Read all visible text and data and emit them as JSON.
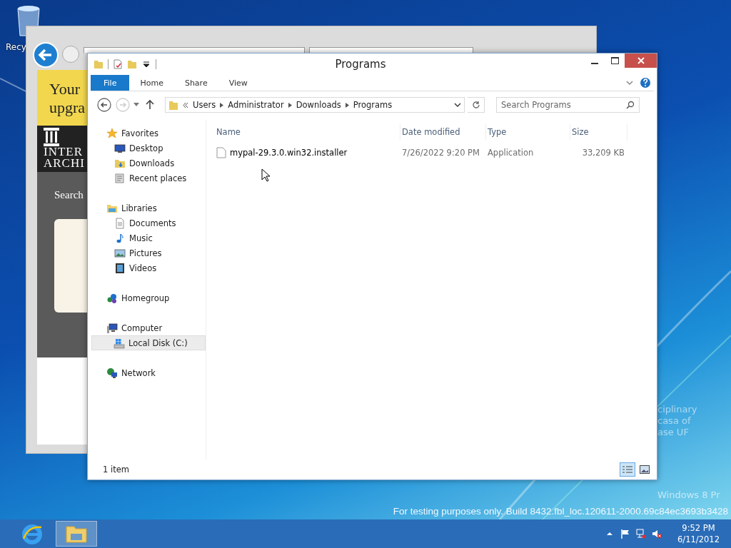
{
  "desktop": {
    "recycle_bin_label": "Recy",
    "wallpaper_texts": [
      "ciplinary",
      "casa of",
      "ase UF"
    ],
    "edition_text": "Windows 8 Pr",
    "build_text": "For testing purposes only. Build 8432.fbl_loc.120611-2000.69c84ec3693b3428"
  },
  "background_window": {
    "banner_lines": [
      "Your",
      "upgra"
    ],
    "logo_lines": [
      "INTER",
      "ARCHI"
    ],
    "search_label": "Search"
  },
  "explorer": {
    "title": "Programs",
    "ribbon_tabs": [
      {
        "label": "File",
        "selected": true
      },
      {
        "label": "Home",
        "selected": false
      },
      {
        "label": "Share",
        "selected": false
      },
      {
        "label": "View",
        "selected": false
      }
    ],
    "breadcrumb": [
      "Users",
      "Administrator",
      "Downloads",
      "Programs"
    ],
    "search": {
      "placeholder": "Search Programs"
    },
    "navigation": [
      {
        "label": "Favorites",
        "kind": "star",
        "selected": false,
        "children": [
          {
            "label": "Desktop",
            "kind": "desktop",
            "selected": false
          },
          {
            "label": "Downloads",
            "kind": "downloads",
            "selected": false
          },
          {
            "label": "Recent places",
            "kind": "recent",
            "selected": false
          }
        ]
      },
      {
        "label": "Libraries",
        "kind": "library",
        "selected": false,
        "children": [
          {
            "label": "Documents",
            "kind": "document",
            "selected": false
          },
          {
            "label": "Music",
            "kind": "music",
            "selected": false
          },
          {
            "label": "Pictures",
            "kind": "pictures",
            "selected": false
          },
          {
            "label": "Videos",
            "kind": "videos",
            "selected": false
          }
        ]
      },
      {
        "label": "Homegroup",
        "kind": "homegroup",
        "selected": false
      },
      {
        "label": "Computer",
        "kind": "computer",
        "selected": false,
        "children": [
          {
            "label": "Local Disk (C:)",
            "kind": "disk",
            "selected": true
          }
        ]
      },
      {
        "label": "Network",
        "kind": "network",
        "selected": false
      }
    ],
    "columns": [
      "Name",
      "Date modified",
      "Type",
      "Size"
    ],
    "rows": [
      {
        "name": "mypal-29.3.0.win32.installer",
        "date_modified": "7/26/2022 9:20 PM",
        "type": "Application",
        "size": "33,209 KB"
      }
    ],
    "status": "1 item",
    "views": [
      {
        "kind": "details",
        "selected": true
      },
      {
        "kind": "thumbnails",
        "selected": false
      }
    ]
  },
  "taskbar": {
    "apps": [
      {
        "kind": "browser",
        "selected": false
      },
      {
        "kind": "explorer",
        "selected": true
      }
    ],
    "time": "9:52 PM",
    "date": "6/11/2012"
  }
}
